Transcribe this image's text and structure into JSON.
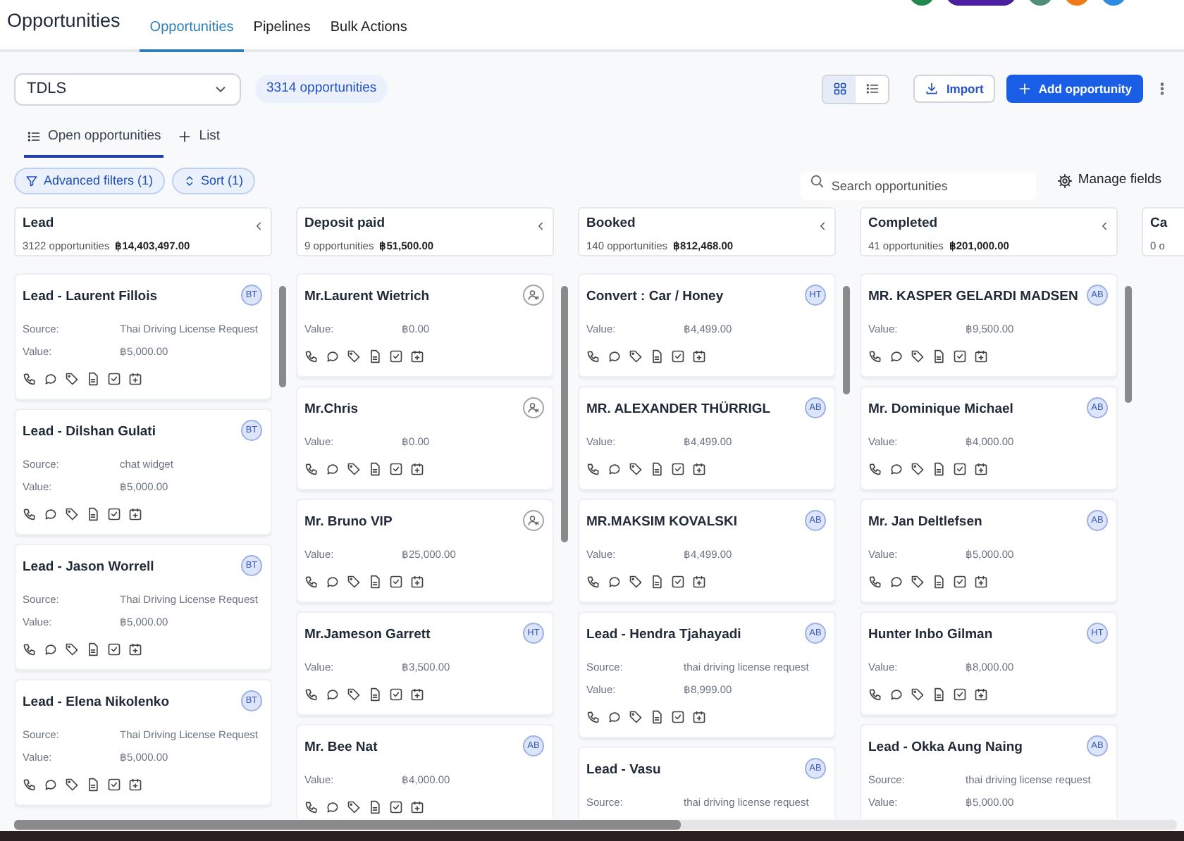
{
  "header": {
    "title": "Opportunities",
    "tabs": [
      {
        "label": "Opportunities",
        "selected": true
      },
      {
        "label": "Pipelines",
        "selected": false
      },
      {
        "label": "Bulk Actions",
        "selected": false
      }
    ]
  },
  "toolbar": {
    "pipeline": "TDLS",
    "count": "3314 opportunities",
    "views": [
      {
        "kind": "grid",
        "selected": true
      },
      {
        "kind": "list",
        "selected": false
      }
    ],
    "import": "Import",
    "add": "Add opportunity"
  },
  "view_tabs": [
    {
      "label": "Open opportunities",
      "kind": "list",
      "selected": true
    },
    {
      "label": "List",
      "kind": "add",
      "selected": false
    }
  ],
  "filters": [
    {
      "label": "Advanced filters (1)",
      "kind": "filter"
    },
    {
      "label": "Sort (1)",
      "kind": "sort"
    }
  ],
  "search": {
    "placeholder": "Search opportunities"
  },
  "manage_fields": "Manage fields",
  "columns": [
    {
      "name": "Lead",
      "count": "3122 opportunities",
      "total": "฿14,403,497.00",
      "cards": [
        {
          "title": "Lead - Laurent Fillois",
          "owner": {
            "kind": "initials",
            "text": "BT"
          },
          "fields": [
            {
              "label": "Source:",
              "value": "Thai Driving License Request"
            },
            {
              "label": "Value:",
              "value": "฿5,000.00"
            }
          ]
        },
        {
          "title": "Lead - Dilshan Gulati",
          "owner": {
            "kind": "initials",
            "text": "BT"
          },
          "fields": [
            {
              "label": "Source:",
              "value": "chat widget"
            },
            {
              "label": "Value:",
              "value": "฿5,000.00"
            }
          ]
        },
        {
          "title": "Lead - Jason Worrell",
          "owner": {
            "kind": "initials",
            "text": "BT"
          },
          "fields": [
            {
              "label": "Source:",
              "value": "Thai Driving License Request"
            },
            {
              "label": "Value:",
              "value": "฿5,000.00"
            }
          ]
        },
        {
          "title": "Lead - Elena Nikolenko",
          "owner": {
            "kind": "initials",
            "text": "BT"
          },
          "fields": [
            {
              "label": "Source:",
              "value": "Thai Driving License Request"
            },
            {
              "label": "Value:",
              "value": "฿5,000.00"
            }
          ]
        }
      ]
    },
    {
      "name": "Deposit paid",
      "count": "9 opportunities",
      "total": "฿51,500.00",
      "cards": [
        {
          "title": "Mr.Laurent Wietrich",
          "owner": {
            "kind": "unassigned"
          },
          "fields": [
            {
              "label": "Value:",
              "value": "฿0.00"
            }
          ]
        },
        {
          "title": "Mr.Chris",
          "owner": {
            "kind": "unassigned"
          },
          "fields": [
            {
              "label": "Value:",
              "value": "฿0.00"
            }
          ]
        },
        {
          "title": "Mr. Bruno VIP",
          "owner": {
            "kind": "unassigned"
          },
          "fields": [
            {
              "label": "Value:",
              "value": "฿25,000.00"
            }
          ]
        },
        {
          "title": "Mr.Jameson Garrett",
          "owner": {
            "kind": "initials",
            "text": "HT"
          },
          "fields": [
            {
              "label": "Value:",
              "value": "฿3,500.00"
            }
          ]
        },
        {
          "title": "Mr. Bee Nat",
          "owner": {
            "kind": "initials",
            "text": "AB"
          },
          "fields": [
            {
              "label": "Value:",
              "value": "฿4,000.00"
            }
          ]
        }
      ]
    },
    {
      "name": "Booked",
      "count": "140 opportunities",
      "total": "฿812,468.00",
      "cards": [
        {
          "title": "Convert : Car / Honey",
          "owner": {
            "kind": "initials",
            "text": "HT"
          },
          "fields": [
            {
              "label": "Value:",
              "value": "฿4,499.00"
            }
          ]
        },
        {
          "title": "MR. ALEXANDER THÜRRIGL",
          "owner": {
            "kind": "initials",
            "text": "AB"
          },
          "fields": [
            {
              "label": "Value:",
              "value": "฿4,499.00"
            }
          ]
        },
        {
          "title": "MR.MAKSIM KOVALSKI",
          "owner": {
            "kind": "initials",
            "text": "AB"
          },
          "fields": [
            {
              "label": "Value:",
              "value": "฿4,499.00"
            }
          ]
        },
        {
          "title": "Lead - Hendra Tjahayadi",
          "owner": {
            "kind": "initials",
            "text": "AB"
          },
          "fields": [
            {
              "label": "Source:",
              "value": "thai driving license request"
            },
            {
              "label": "Value:",
              "value": "฿8,999.00"
            }
          ]
        },
        {
          "title": "Lead - Vasu",
          "owner": {
            "kind": "initials",
            "text": "AB"
          },
          "fields": [
            {
              "label": "Source:",
              "value": "thai driving license request"
            }
          ]
        }
      ]
    },
    {
      "name": "Completed",
      "count": "41 opportunities",
      "total": "฿201,000.00",
      "cards": [
        {
          "title": "MR. KASPER GELARDI MADSEN",
          "owner": {
            "kind": "initials",
            "text": "AB"
          },
          "fields": [
            {
              "label": "Value:",
              "value": "฿9,500.00"
            }
          ]
        },
        {
          "title": "Mr. Dominique Michael",
          "owner": {
            "kind": "initials",
            "text": "AB"
          },
          "fields": [
            {
              "label": "Value:",
              "value": "฿4,000.00"
            }
          ]
        },
        {
          "title": "Mr. Jan Deltlefsen",
          "owner": {
            "kind": "initials",
            "text": "AB"
          },
          "fields": [
            {
              "label": "Value:",
              "value": "฿5,000.00"
            }
          ]
        },
        {
          "title": "Hunter Inbo Gilman",
          "owner": {
            "kind": "initials",
            "text": "HT"
          },
          "fields": [
            {
              "label": "Value:",
              "value": "฿8,000.00"
            }
          ]
        },
        {
          "title": "Lead - Okka Aung Naing",
          "owner": {
            "kind": "initials",
            "text": "AB"
          },
          "fields": [
            {
              "label": "Source:",
              "value": "thai driving license request"
            },
            {
              "label": "Value:",
              "value": "฿5,000.00"
            }
          ]
        }
      ]
    },
    {
      "name": "Ca",
      "count": "0 o"
    }
  ]
}
